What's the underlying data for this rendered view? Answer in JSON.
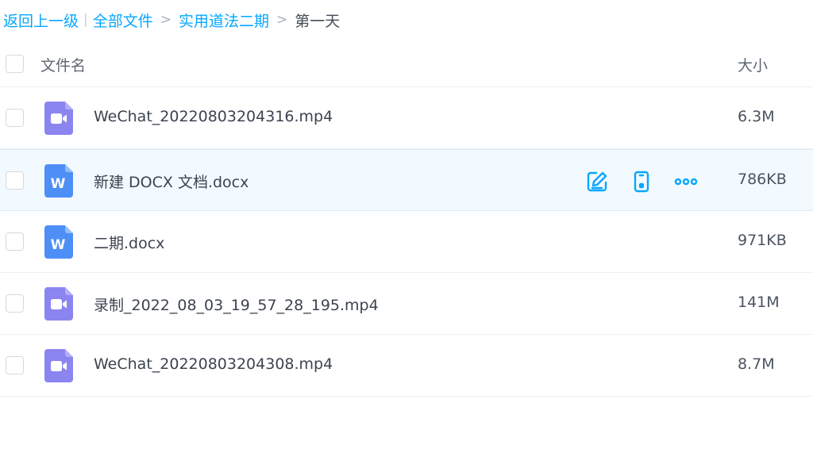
{
  "breadcrumb": {
    "back": "返回上一级",
    "separator": "|",
    "arrow": ">",
    "items": [
      "全部文件",
      "实用道法二期"
    ],
    "current": "第一天"
  },
  "table": {
    "col_name": "文件名",
    "col_size": "大小"
  },
  "files": [
    {
      "name": "WeChat_20220803204316.mp4",
      "size": "6.3M",
      "type": "video-file-icon"
    },
    {
      "name": "新建 DOCX 文档.docx",
      "size": "786KB",
      "type": "word-file-icon"
    },
    {
      "name": "二期.docx",
      "size": "971KB",
      "type": "word-file-icon"
    },
    {
      "name": "录制_2022_08_03_19_57_28_195.mp4",
      "size": "141M",
      "type": "video-file-icon"
    },
    {
      "name": "WeChat_20220803204308.mp4",
      "size": "8.7M",
      "type": "video-file-icon"
    }
  ],
  "hover_row_actions": [
    "edit-icon",
    "phone-icon",
    "more-icon"
  ],
  "colors": {
    "accent": "#06a7ff",
    "video_icon": "#8b85f0",
    "word_icon": "#4d8ff6",
    "hover_bg": "#f3faff"
  }
}
